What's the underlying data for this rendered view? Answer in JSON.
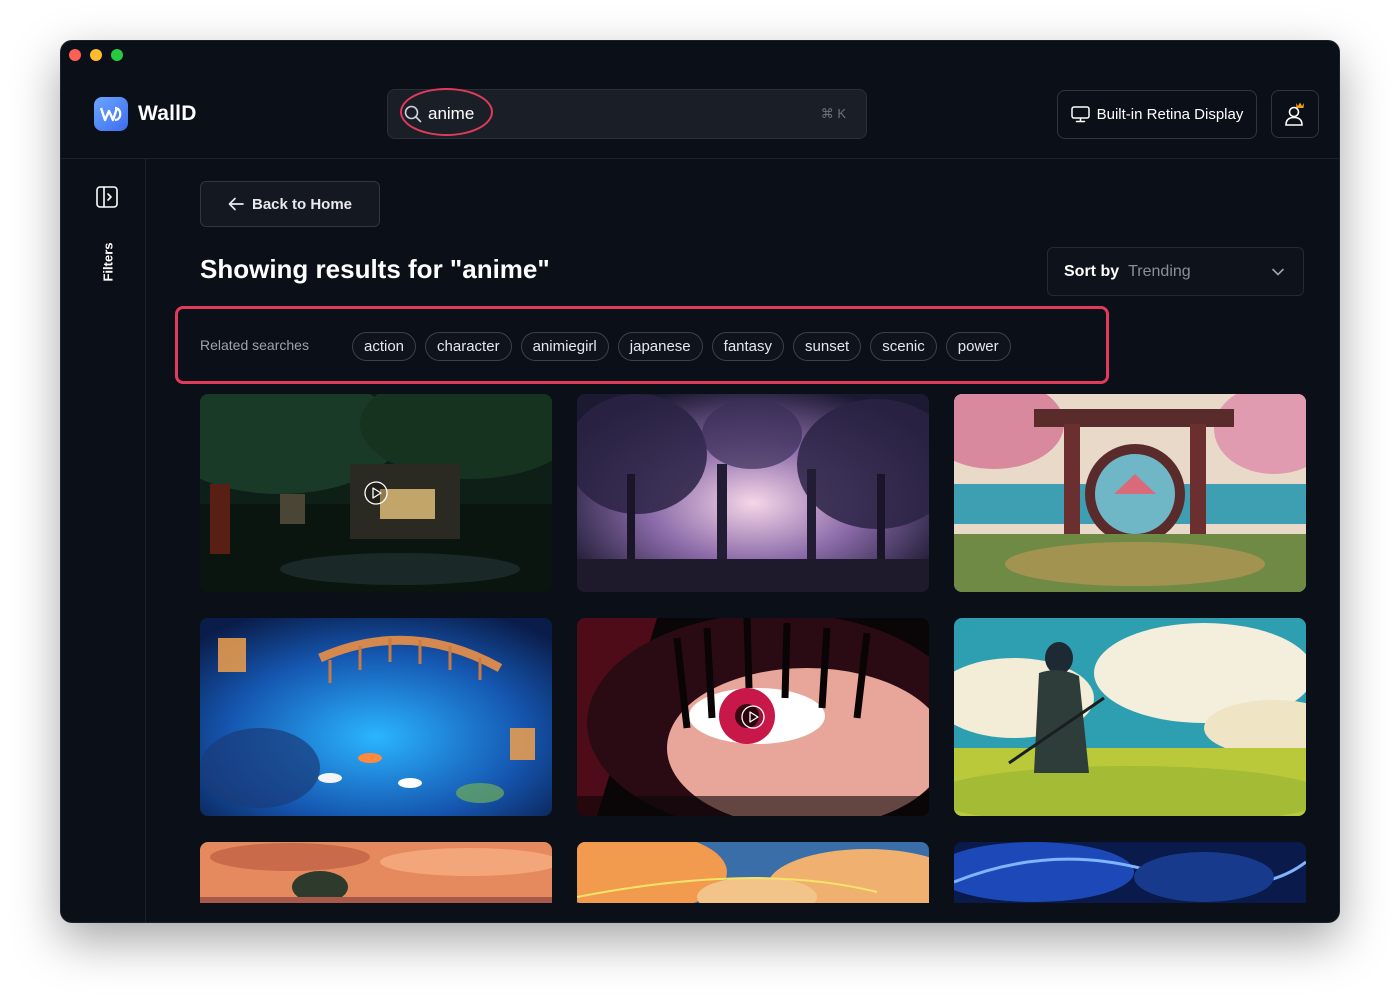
{
  "app": {
    "name": "WallD"
  },
  "search": {
    "value": "anime",
    "shortcut": "⌘ K"
  },
  "header": {
    "display_label": "Built-in Retina Display"
  },
  "sidebar": {
    "filters_label": "Filters"
  },
  "main": {
    "back_label": "Back to Home",
    "results_title": "Showing results for \"anime\"",
    "sort_label": "Sort by",
    "sort_value": "Trending",
    "related_label": "Related searches",
    "related_tags": [
      "action",
      "character",
      "animiegirl",
      "japanese",
      "fantasy",
      "sunset",
      "scenic",
      "power"
    ]
  },
  "wallpapers": [
    {
      "scene": "forest-shop-night",
      "has_video": true
    },
    {
      "scene": "misty-purple-forest",
      "has_video": false
    },
    {
      "scene": "torii-gate-cherry-blossoms",
      "has_video": false
    },
    {
      "scene": "koi-pond-bridge-lanterns",
      "has_video": false
    },
    {
      "scene": "red-eye-closeup",
      "has_video": true
    },
    {
      "scene": "samurai-meadow-clouds",
      "has_video": false
    },
    {
      "scene": "sunset-island",
      "has_video": false
    },
    {
      "scene": "orange-clouds-sky",
      "has_video": false
    },
    {
      "scene": "blue-dragon-energy",
      "has_video": false
    }
  ],
  "colors": {
    "accent_highlight": "#e23a5c",
    "background": "#0b0f17",
    "logo": "#4f86f7"
  }
}
